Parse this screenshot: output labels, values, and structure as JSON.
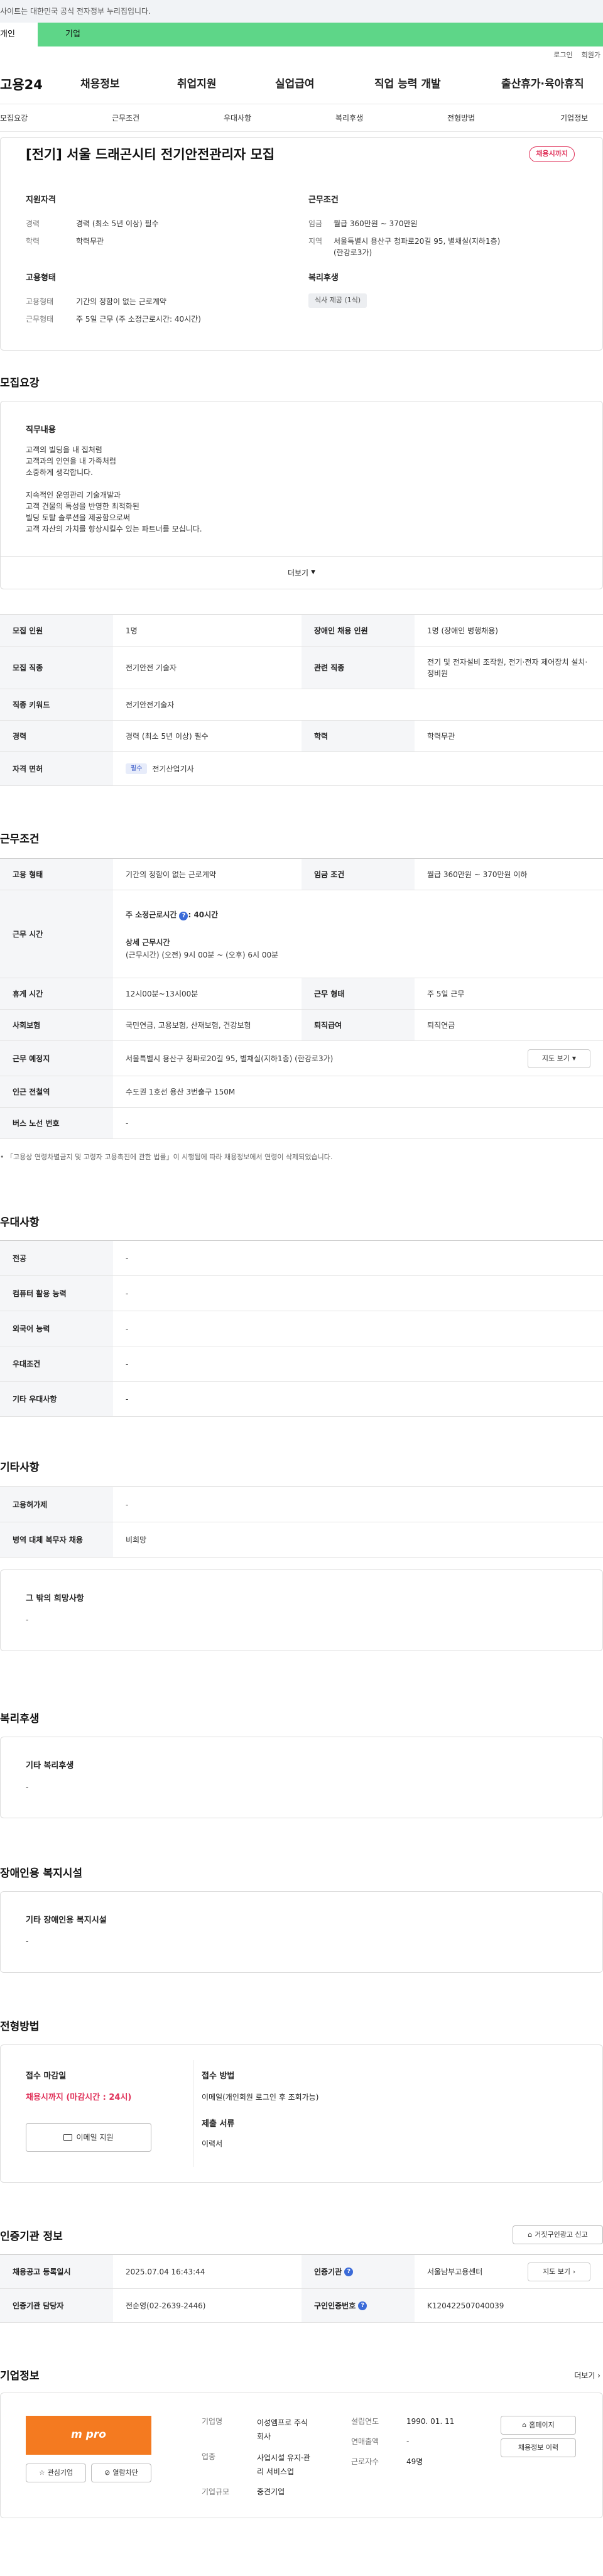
{
  "notice": "사이트는 대한민국 공식 전자정부 누리집입니다.",
  "site_tabs": {
    "personal": "개인",
    "company": "기업"
  },
  "util": {
    "login": "로그인",
    "join": "회원가"
  },
  "gnb": {
    "logo": "고용24",
    "items": [
      "채용정보",
      "취업지원",
      "실업급여",
      "직업 능력 개발",
      "출산휴가·육아휴직"
    ]
  },
  "snb": {
    "items": [
      "모집요강",
      "근무조건",
      "우대사항",
      "복리후생",
      "전형방법",
      "기업정보"
    ]
  },
  "job": {
    "title": "[전기] 서울 드래곤시티 전기안전관리자 모집",
    "status_badge": "채용시까지",
    "qual_heading": "지원자격",
    "career_k": "경력",
    "career_v": "경력 (최소 5년 이상) 필수",
    "edu_k": "학력",
    "edu_v": "학력무관",
    "cond_heading": "근무조건",
    "wage_k": "임금",
    "wage_v": "월급 360만원 ~ 370만원",
    "region_k": "지역",
    "region_v1": "서울특별시 용산구 청파로20길 95, 별채실(지하1층)",
    "region_v2": "(한강로3가)",
    "emp_heading": "고용형태",
    "emp_k": "고용형태",
    "emp_v": "기간의 정함이 없는 근로계약",
    "hours_k": "근무형태",
    "hours_v": "주 5일 근무 (주 소정근로시간: 40시간)",
    "welfare_heading": "복리후생",
    "welfare_chip": "식사 제공 (1식)"
  },
  "recruit": {
    "section_title": "모집요강",
    "duty_heading": "직무내용",
    "duty_lines": [
      "고객의 빌딩을 내 집처럼",
      "고객과의 인연을 내 가족처럼",
      "소중하게 생각합니다.",
      "",
      "지속적인 운영관리 기술개발과",
      "고객 건물의 특성을 반영한 최적화된",
      "빌딩 토탈 솔루션을 제공함으로써",
      "고객 자산의 가치를 향상시킬수 있는 파트너를 모십니다."
    ],
    "more": "더보기",
    "rows": [
      {
        "k1": "모집 인원",
        "v1": "1명",
        "k2": "장애인 채용 인원",
        "v2": "1명 (장애인 병행채용)"
      },
      {
        "k1": "모집 직종",
        "v1": "전기안전 기술자",
        "k2": "관련 직종",
        "v2": "전기 및 전자설비 조작원, 전기·전자 제어장치 설치·정비원"
      },
      {
        "k1": "직종 키워드",
        "v1": "전기안전기술자"
      },
      {
        "k1": "경력",
        "v1": "경력 (최소 5년 이상) 필수",
        "k2": "학력",
        "v2": "학력무관"
      },
      {
        "k1": "자격 면허",
        "chip": "필수",
        "v1": "전기산업기사"
      }
    ]
  },
  "conditions": {
    "section_title": "근무조건",
    "emp_k": "고용 형태",
    "emp_v": "기간의 정함이 없는 근로계약",
    "wage_k": "임금 조건",
    "wage_v": "월급 360만원 ~ 370만원 이하",
    "time_k": "근무 시간",
    "weekly_label": "주 소정근로시간",
    "weekly_v": ": 40시간",
    "detail_label": "상세 근무시간",
    "detail_v": "(근무시간) (오전) 9시 00분 ~ (오후) 6시 00분",
    "break_k": "휴게 시간",
    "break_v": "12시00분~13시00분",
    "type_k": "근무 형태",
    "type_v": "주 5일 근무",
    "ins_k": "사회보험",
    "ins_v": "국민연금, 고용보험, 산재보험, 건강보험",
    "ret_k": "퇴직급여",
    "ret_v": "퇴직연금",
    "place_k": "근무 예정지",
    "place_v": "서울특별시 용산구 청파로20길 95, 별채실(지하1층) (한강로3가)",
    "map_btn": "지도 보기",
    "subway_k": "인근 전철역",
    "subway_v": "수도권 1호선 용산 3번출구 150M",
    "bus_k": "버스 노선 번호",
    "bus_v": "-",
    "note": "「고용상 연령차별금지 및 고령자 고용촉진에 관한 법률」이 시행됨에 따라 채용정보에서 연령이 삭제되었습니다."
  },
  "pref": {
    "section_title": "우대사항",
    "rows": [
      {
        "k": "전공",
        "v": "-"
      },
      {
        "k": "컴퓨터 활용 능력",
        "v": "-"
      },
      {
        "k": "외국어 능력",
        "v": "-"
      },
      {
        "k": "우대조건",
        "v": "-"
      },
      {
        "k": "기타 우대사항",
        "v": "-"
      }
    ]
  },
  "etc": {
    "section_title": "기타사항",
    "rows": [
      {
        "k": "고용허가제",
        "v": "-"
      },
      {
        "k": "병역 대체 복무자 채용",
        "v": "비희망"
      }
    ],
    "other_heading": "그 밖의 희망사항",
    "other_v": "-"
  },
  "welfare": {
    "section_title": "복리후생",
    "heading": "기타 복리후생",
    "value": "-"
  },
  "disabled": {
    "section_title": "장애인용 복지시설",
    "heading": "기타 장애인용 복지시설",
    "value": "-"
  },
  "selection": {
    "section_title": "전형방법",
    "deadline_heading": "접수 마감일",
    "deadline_v": "채용시까지 (마감시간 : 24시)",
    "email_btn": "이메일 지원",
    "method_heading": "접수 방법",
    "method_v": "이메일(개인회원 로그인 후 조회가능)",
    "docs_heading": "제출 서류",
    "docs_v": "이력서"
  },
  "cert": {
    "section_title": "인증기관 정보",
    "report_btn": "거짓구인광고 신고",
    "reg_k": "채용공고 등록일시",
    "reg_v": "2025.07.04 16:43:44",
    "org_k": "인증기관",
    "org_v": "서울남부고용센터",
    "map_btn": "지도 보기",
    "mgr_k": "인증기관 담당자",
    "mgr_v": "전순영(02-2639-2446)",
    "no_k": "구인인증번호",
    "no_v": "K120422507040039"
  },
  "company": {
    "section_title": "기업정보",
    "more": "더보기",
    "logo_text": "m pro",
    "fav_btn": "관심기업",
    "block_btn": "열람차단",
    "name_k": "기업명",
    "name_v1": "이성엠프로 주식",
    "name_v2": "회사",
    "biz_k": "업종",
    "biz_v1": "사업시설 유지·관",
    "biz_v2": "리 서비스업",
    "size_k": "기업규모",
    "size_v": "중견기업",
    "year_k": "설립연도",
    "year_v": "1990. 01. 11",
    "sales_k": "연매출액",
    "sales_v": "-",
    "emp_k": "근로자수",
    "emp_v": "49명",
    "home_btn": "홈페이지",
    "jobs_btn": "채용정보 이력",
    "brand_color": "#f47a20"
  }
}
